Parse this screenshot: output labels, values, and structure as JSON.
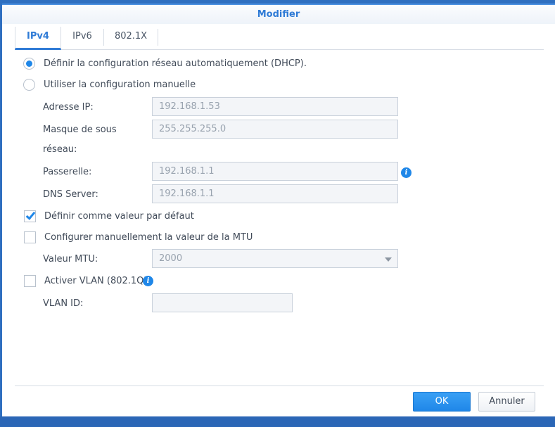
{
  "dialog": {
    "title": "Modifier"
  },
  "tabs": [
    {
      "label": "IPv4",
      "active": true
    },
    {
      "label": "IPv6",
      "active": false
    },
    {
      "label": "802.1X",
      "active": false
    }
  ],
  "options": {
    "dhcp": {
      "label": "Définir la configuration réseau automatiquement (DHCP).",
      "checked": true
    },
    "manual": {
      "label": "Utiliser la configuration manuelle",
      "checked": false
    }
  },
  "fields": {
    "ip": {
      "label": "Adresse IP:",
      "value": "192.168.1.53"
    },
    "mask": {
      "label_line1": "Masque de sous",
      "label_line2": "réseau:",
      "value": "255.255.255.0"
    },
    "gateway": {
      "label": "Passerelle:",
      "value": "192.168.1.1"
    },
    "dns": {
      "label": "DNS Server:",
      "value": "192.168.1.1"
    }
  },
  "default_gateway": {
    "label": "Définir comme valeur par défaut",
    "checked": true
  },
  "mtu": {
    "checkbox_label": "Configurer manuellement la valeur de la MTU",
    "checked": false,
    "value_label": "Valeur MTU:",
    "value": "2000"
  },
  "vlan": {
    "checkbox_label": "Activer VLAN (802.1Q)",
    "checked": false,
    "id_label": "VLAN ID:",
    "id_value": ""
  },
  "buttons": {
    "ok": "OK",
    "cancel": "Annuler"
  },
  "colors": {
    "accent": "#1f87e8",
    "title": "#2f7bd6",
    "backdrop": "#2f6fc0"
  }
}
